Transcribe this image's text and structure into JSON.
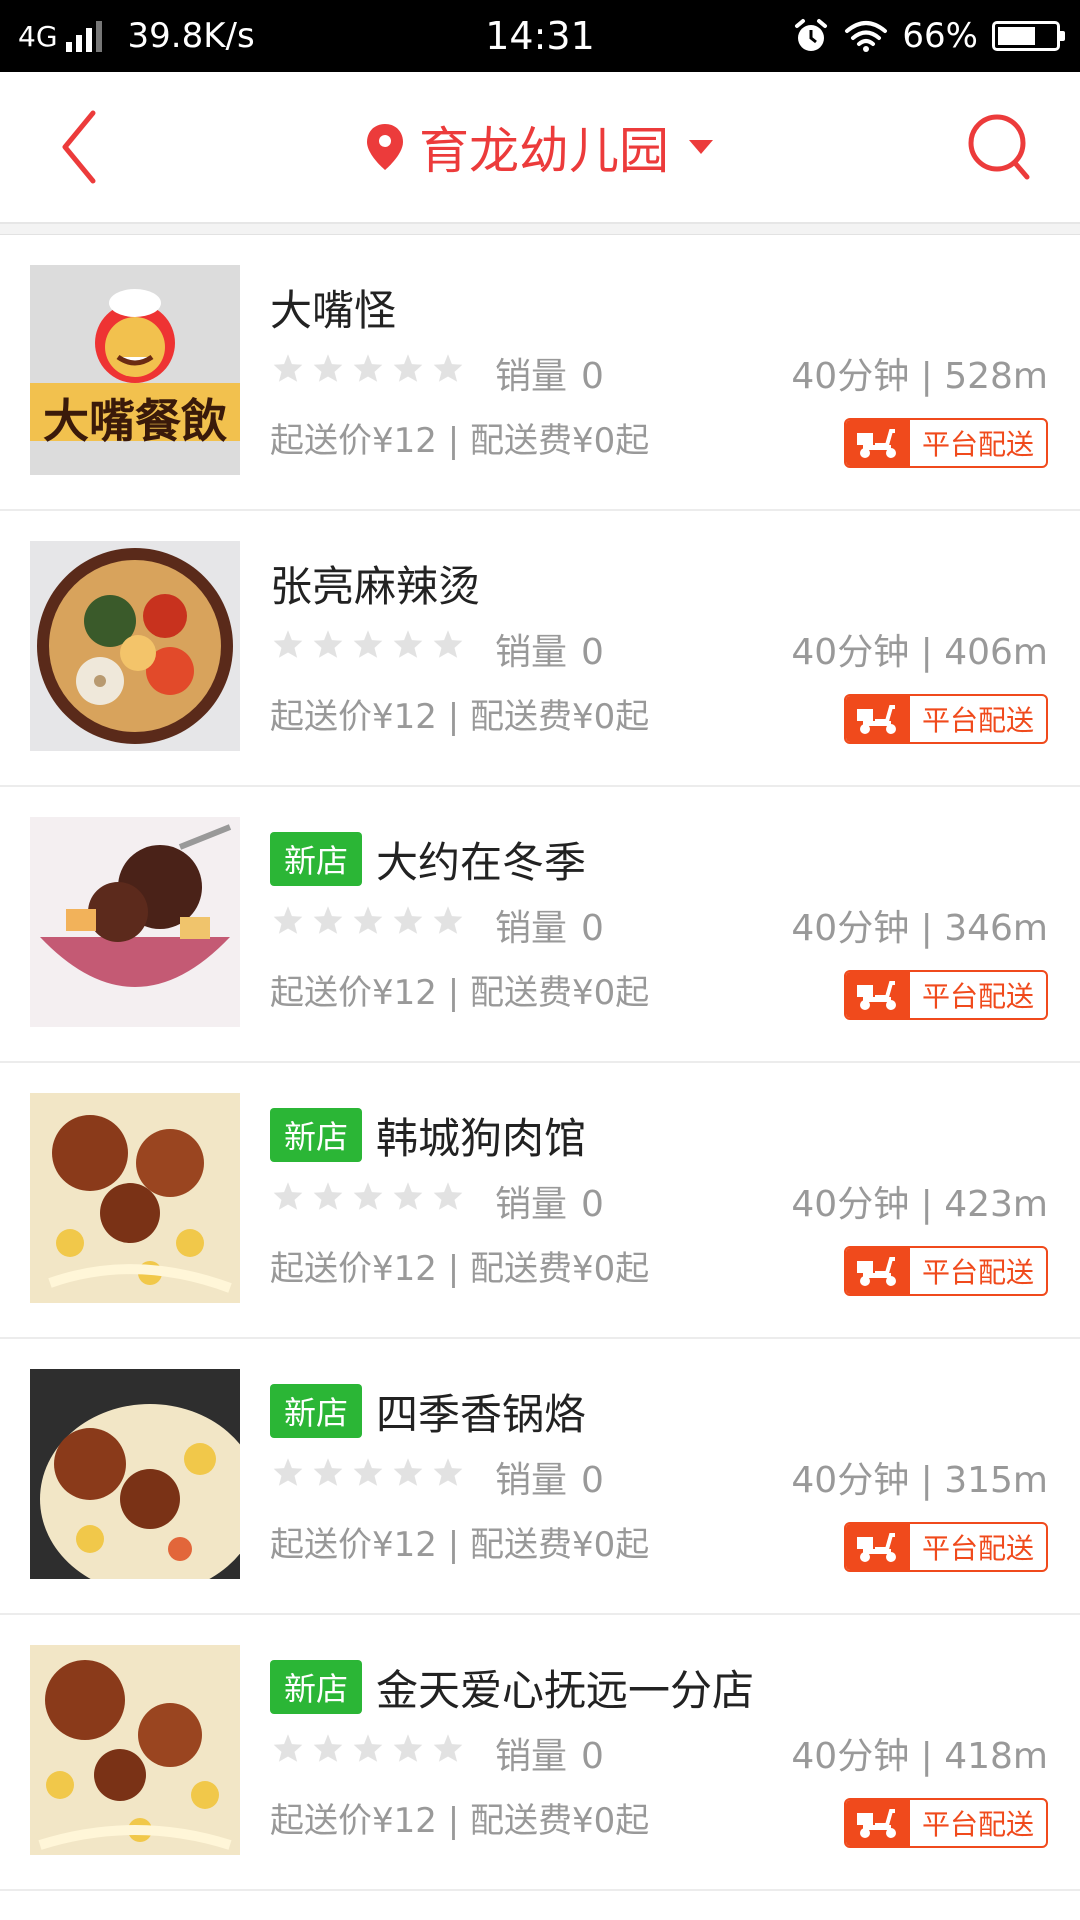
{
  "status_bar": {
    "network": "4G",
    "speed": "39.8K/s",
    "time": "14:31",
    "battery": "66%",
    "battery_level": 0.66
  },
  "header": {
    "location": "育龙幼儿园"
  },
  "shops": [
    {
      "name": "大嘴怪",
      "is_new": false,
      "new_label": "",
      "rating": 0,
      "sales_label": "销量",
      "sales": "0",
      "time_distance": "40分钟 | 528m",
      "fee_text": "起送价¥12 | 配送费¥0起",
      "delivery": "平台配送",
      "thumb_logo_text": "大嘴餐飲"
    },
    {
      "name": "张亮麻辣烫",
      "is_new": false,
      "new_label": "",
      "rating": 0,
      "sales_label": "销量",
      "sales": "0",
      "time_distance": "40分钟 | 406m",
      "fee_text": "起送价¥12 | 配送费¥0起",
      "delivery": "平台配送"
    },
    {
      "name": "大约在冬季",
      "is_new": true,
      "new_label": "新店",
      "rating": 0,
      "sales_label": "销量",
      "sales": "0",
      "time_distance": "40分钟 | 346m",
      "fee_text": "起送价¥12 | 配送费¥0起",
      "delivery": "平台配送"
    },
    {
      "name": "韩城狗肉馆",
      "is_new": true,
      "new_label": "新店",
      "rating": 0,
      "sales_label": "销量",
      "sales": "0",
      "time_distance": "40分钟 | 423m",
      "fee_text": "起送价¥12 | 配送费¥0起",
      "delivery": "平台配送"
    },
    {
      "name": "四季香锅烙",
      "is_new": true,
      "new_label": "新店",
      "rating": 0,
      "sales_label": "销量",
      "sales": "0",
      "time_distance": "40分钟 | 315m",
      "fee_text": "起送价¥12 | 配送费¥0起",
      "delivery": "平台配送"
    },
    {
      "name": "金天爱心抚远一分店",
      "is_new": true,
      "new_label": "新店",
      "rating": 0,
      "sales_label": "销量",
      "sales": "0",
      "time_distance": "40分钟 | 418m",
      "fee_text": "起送价¥12 | 配送费¥0起",
      "delivery": "平台配送"
    }
  ],
  "colors": {
    "accent": "#ec3b3b",
    "new_badge": "#2bb636",
    "delivery": "#f04a1c",
    "muted": "#999999",
    "star": "#e2e2e2"
  }
}
